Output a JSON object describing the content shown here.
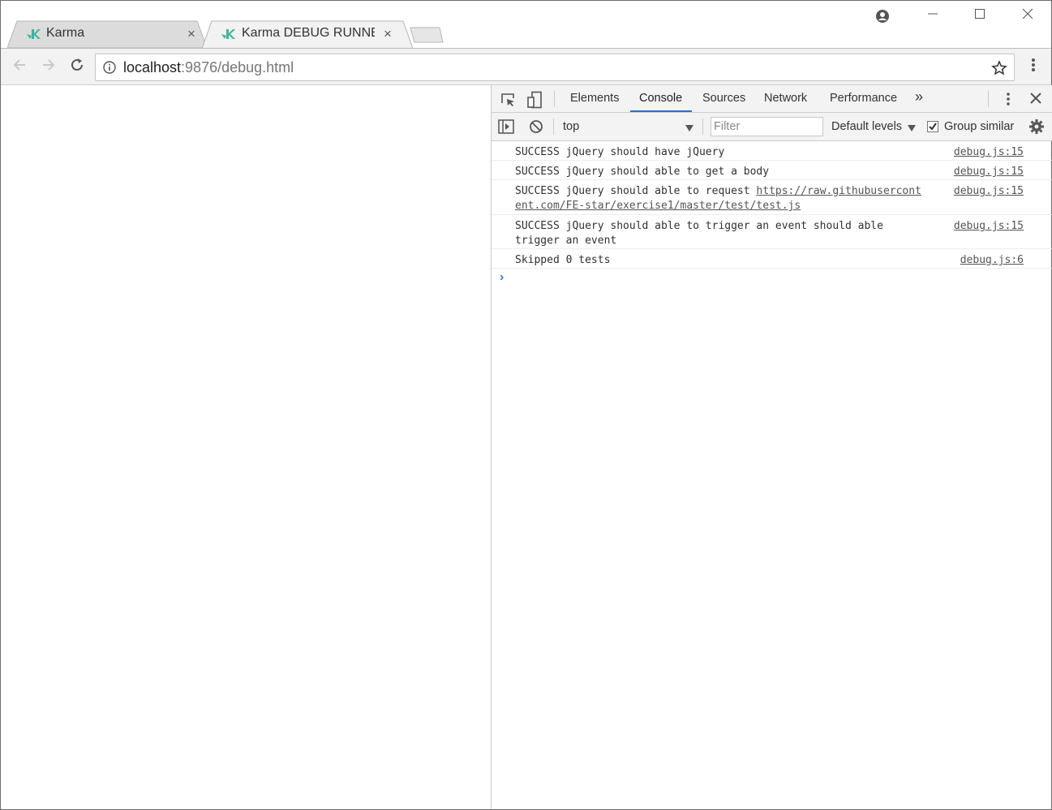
{
  "tabs": [
    {
      "title": "Karma",
      "close": "×"
    },
    {
      "title": "Karma DEBUG RUNNER",
      "close": "×"
    }
  ],
  "address": {
    "host": "localhost",
    "path": ":9876/debug.html"
  },
  "devtools": {
    "tabs": [
      "Elements",
      "Console",
      "Sources",
      "Network",
      "Performance"
    ],
    "more": "»",
    "context": "top",
    "filter_placeholder": "Filter",
    "levels": "Default levels",
    "group_similar": "Group similar"
  },
  "console": {
    "messages": [
      {
        "text": "SUCCESS jQuery should have jQuery",
        "source": "debug.js:15"
      },
      {
        "text": "SUCCESS jQuery should able to get a body",
        "source": "debug.js:15"
      },
      {
        "text_prefix": "SUCCESS jQuery should able to request ",
        "link_line1": "https://raw.githubusercont",
        "link_line2": "ent.com/FE-star/exercise1/master/test/test.js",
        "source": "debug.js:15"
      },
      {
        "text_line1": "SUCCESS jQuery should able to trigger an event should able",
        "text_line2": "trigger an event",
        "source": "debug.js:15"
      },
      {
        "text": "Skipped 0 tests",
        "source": "debug.js:6"
      }
    ],
    "prompt": "›"
  },
  "colors": {
    "accent": "#1a73e8",
    "karma": "#3bb5a0"
  }
}
